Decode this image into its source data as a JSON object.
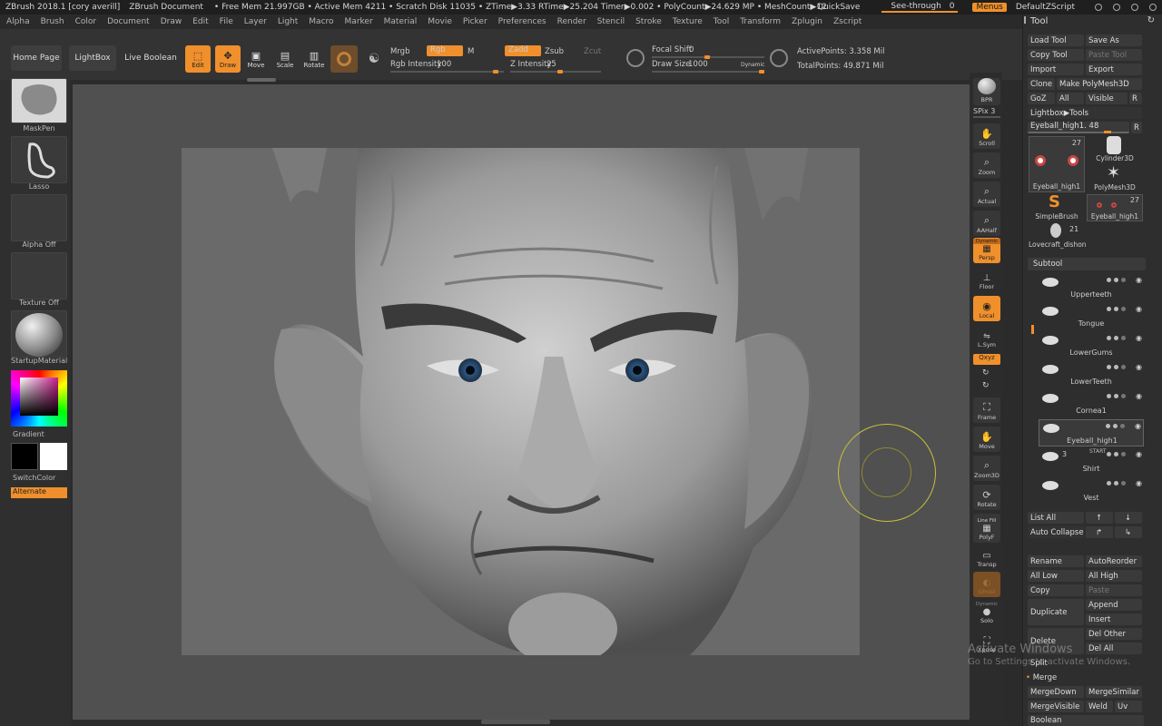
{
  "titlebar": {
    "app": "ZBrush 2018.1 [cory averill]",
    "doc": "ZBrush Document",
    "stats": "• Free Mem 21.997GB • Active Mem 4211 • Scratch Disk 11035 • ZTime▶3.33 RTime▶25.204 Timer▶0.002 • PolyCount▶24.629 MP • MeshCount▶12",
    "quicksave": "QuickSave",
    "seethrough": "See-through",
    "seethrough_value": "0",
    "menus": "Menus",
    "script": "DefaultZScript"
  },
  "menubar": [
    "Alpha",
    "Brush",
    "Color",
    "Document",
    "Draw",
    "Edit",
    "File",
    "Layer",
    "Light",
    "Macro",
    "Marker",
    "Material",
    "Movie",
    "Picker",
    "Preferences",
    "Render",
    "Stencil",
    "Stroke",
    "Texture",
    "Tool",
    "Transform",
    "Zplugin",
    "Zscript"
  ],
  "topshelf": {
    "home": "Home Page",
    "lightbox": "LightBox",
    "liveboolean": "Live Boolean",
    "edit": "Edit",
    "draw": "Draw",
    "move": "Move",
    "scale": "Scale",
    "rotate": "Rotate",
    "mrgb": "Mrgb",
    "rgb": "Rgb",
    "m": "M",
    "rgb_intensity_label": "Rgb Intensity",
    "rgb_intensity": "100",
    "zadd": "Zadd",
    "zsub": "Zsub",
    "zcut": "Zcut",
    "z_intensity_label": "Z Intensity",
    "z_intensity": "25",
    "focal_label": "Focal Shift",
    "focal": "0",
    "drawsize_label": "Draw Size",
    "drawsize": "1000",
    "dynamic": "Dynamic",
    "active_points": "ActivePoints: 3.358 Mil",
    "total_points": "TotalPoints: 49.871 Mil"
  },
  "leftpanel": {
    "brush": "MaskPen",
    "stroke": "Lasso",
    "alpha": "Alpha Off",
    "texture": "Texture Off",
    "material": "StartupMaterial",
    "gradient": "Gradient",
    "switchcolor": "SwitchColor",
    "alternate": "Alternate"
  },
  "rightshelf": {
    "bpr": "BPR",
    "spix_label": "SPix",
    "spix": "3",
    "scroll": "Scroll",
    "zoom": "Zoom",
    "actual": "Actual",
    "aahalf": "AAHalf",
    "dynamic": "Dynamic",
    "persp": "Persp",
    "floor": "Floor",
    "local": "Local",
    "lsym": "L.Sym",
    "xyz": "Qxyz",
    "frame": "Frame",
    "move": "Move",
    "zoom3d": "Zoom3D",
    "rotate": "Rotate",
    "linefill": "Line Fill",
    "polyf": "PolyF",
    "transp": "Transp",
    "ghost": "Ghost",
    "solo_dyn": "Dynamic",
    "solo": "Solo",
    "xpose": "Xpose"
  },
  "toolpanel": {
    "title": "Tool",
    "load": "Load Tool",
    "saveas": "Save As",
    "copy": "Copy Tool",
    "paste": "Paste Tool",
    "import": "Import",
    "export": "Export",
    "clone": "Clone",
    "makepoly": "Make PolyMesh3D",
    "goz": "GoZ",
    "all": "All",
    "visible": "Visible",
    "r": "R",
    "lightbox_tools": "Lightbox▶Tools",
    "current": "Eyeball_high1. 48",
    "thumb1_name": "Eyeball_high1",
    "thumb1_count": "27",
    "thumb2_name": "Cylinder3D",
    "thumb3_name": "PolyMesh3D",
    "thumb4_name": "SimpleBrush",
    "thumb5_name": "Eyeball_high1",
    "thumb5_count": "27",
    "thumb6_name": "Lovecraft_dishon",
    "thumb6_count": "21",
    "subtool": "Subtool",
    "subtools": [
      {
        "name": "Upperteeth"
      },
      {
        "name": "Tongue"
      },
      {
        "name": "LowerGums"
      },
      {
        "name": "LowerTeeth"
      },
      {
        "name": "Cornea1"
      },
      {
        "name": "Eyeball_high1"
      },
      {
        "name": "Shirt",
        "count": "3",
        "tag": "START"
      },
      {
        "name": "Vest"
      }
    ],
    "listall": "List All",
    "autocollapse": "Auto Collapse",
    "rename": "Rename",
    "autoreorder": "AutoReorder",
    "alllow": "All Low",
    "allhigh": "All High",
    "copy2": "Copy",
    "paste2": "Paste",
    "duplicate": "Duplicate",
    "append": "Append",
    "insert": "Insert",
    "delete": "Delete",
    "delother": "Del Other",
    "delall": "Del All",
    "split": "Split",
    "merge": "Merge",
    "mergedown": "MergeDown",
    "mergesimilar": "MergeSimilar",
    "mergevisible": "MergeVisible",
    "weld": "Weld",
    "uv": "Uv",
    "boolean": "Boolean"
  },
  "watermark": {
    "line1": "Activate Windows",
    "line2": "Go to Settings to activate Windows."
  }
}
